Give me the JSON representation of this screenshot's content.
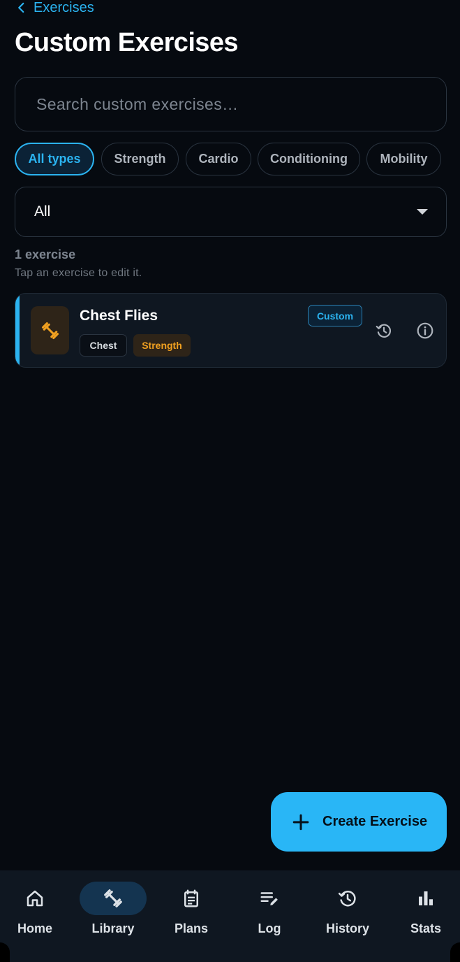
{
  "header": {
    "back_label": "Exercises",
    "title": "Custom Exercises"
  },
  "search": {
    "placeholder": "Search custom exercises…",
    "value": ""
  },
  "type_filters": [
    {
      "label": "All types",
      "active": true
    },
    {
      "label": "Strength",
      "active": false
    },
    {
      "label": "Cardio",
      "active": false
    },
    {
      "label": "Conditioning",
      "active": false
    },
    {
      "label": "Mobility",
      "active": false
    }
  ],
  "muscle_select": {
    "value": "All",
    "icon": "caret-down-icon"
  },
  "results": {
    "count_label": "1 exercise",
    "hint": "Tap an exercise to edit it."
  },
  "exercises": [
    {
      "name": "Chest Flies",
      "icon": "dumbbell-icon",
      "muscle": "Chest",
      "type": "Strength",
      "badge": "Custom"
    }
  ],
  "fab": {
    "label": "Create Exercise",
    "icon": "plus-icon"
  },
  "bottom_nav": [
    {
      "label": "Home",
      "icon": "home-icon",
      "active": false
    },
    {
      "label": "Library",
      "icon": "dumbbell-icon",
      "active": true
    },
    {
      "label": "Plans",
      "icon": "clipboard-icon",
      "active": false
    },
    {
      "label": "Log",
      "icon": "edit-list-icon",
      "active": false
    },
    {
      "label": "History",
      "icon": "history-icon",
      "active": false
    },
    {
      "label": "Stats",
      "icon": "bar-chart-icon",
      "active": false
    }
  ],
  "colors": {
    "background": "#060a10",
    "accent": "#29b6f6",
    "strength": "#f0a020",
    "surface": "#0f1721"
  }
}
